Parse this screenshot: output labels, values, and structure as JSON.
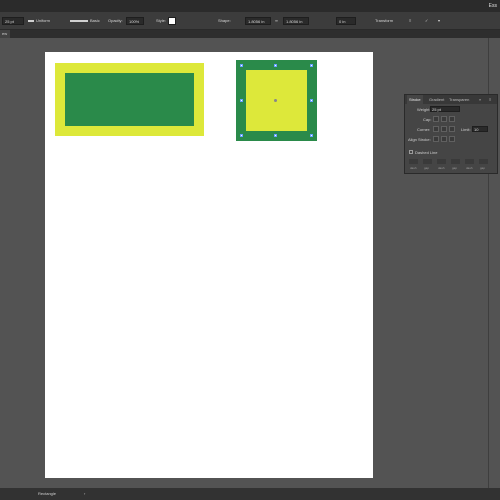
{
  "app": {
    "title_fragment": "Ess"
  },
  "control_bar": {
    "stroke_weight": "25 pt",
    "stroke_style": "Uniform",
    "brush": "Basic",
    "opacity_label": "Opacity:",
    "opacity_value": "100%",
    "style_label": "Style:",
    "shape_label": "Shape:",
    "width_value": "1.8056 in",
    "height_value": "1.8056 in",
    "angle_value": "0 in",
    "transform_label": "Transform"
  },
  "document_tab": {
    "label": "ew"
  },
  "canvas": {
    "accent_green": "#2a8a4a",
    "accent_yellow": "#dde83a"
  },
  "stroke_panel": {
    "tabs": [
      {
        "label": "Stroke",
        "active": true
      },
      {
        "label": "Gradient",
        "active": false
      },
      {
        "label": "Transparen",
        "active": false
      }
    ],
    "weight_label": "Weight:",
    "weight_value": "25 pt",
    "cap_label": "Cap:",
    "corner_label": "Corner:",
    "limit_label": "Limit:",
    "limit_value": "10",
    "align_label": "Align Stroke:",
    "dashed_label": "Dashed Line",
    "dash_labels": [
      "dash",
      "gap",
      "dash",
      "gap",
      "dash",
      "gap"
    ]
  },
  "status_bar": {
    "zoom": "",
    "tool": "Rectangle"
  }
}
